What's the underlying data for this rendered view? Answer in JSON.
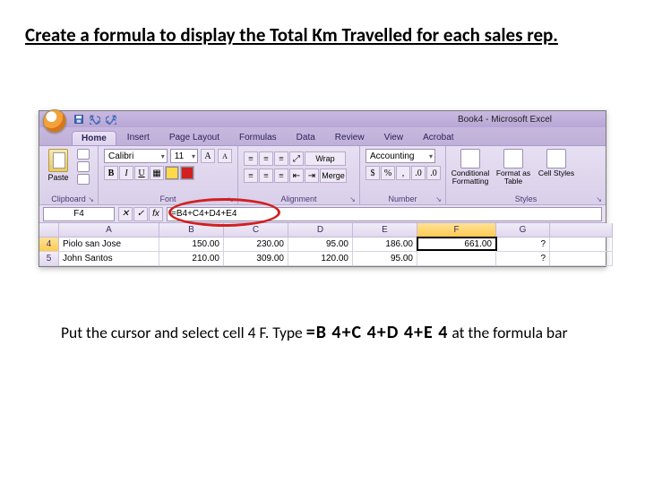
{
  "heading": "Create a formula to display the Total Km Travelled for each sales rep.",
  "window_title": "Book4 - Microsoft Excel",
  "tabs": [
    "Home",
    "Insert",
    "Page Layout",
    "Formulas",
    "Data",
    "Review",
    "View",
    "Acrobat"
  ],
  "ribbon": {
    "clipboard": {
      "paste": "Paste",
      "label": "Clipboard"
    },
    "font": {
      "face": "Calibri",
      "size": "11",
      "label": "Font",
      "buttons": {
        "bold": "B",
        "italic": "I",
        "underline": "U"
      }
    },
    "alignment": {
      "label": "Alignment"
    },
    "number": {
      "format": "Accounting",
      "label": "Number"
    },
    "styles": {
      "cond": "Conditional Formatting",
      "table": "Format as Table",
      "cell": "Cell Styles",
      "label": "Styles"
    }
  },
  "namebox": "F4",
  "formula": "=B4+C4+D4+E4",
  "grid": {
    "cols": [
      "",
      "A",
      "B",
      "C",
      "D",
      "E",
      "F",
      "G",
      ""
    ],
    "sel_col_index": 6,
    "rows": [
      {
        "num": "4",
        "selected": true,
        "cells": [
          "Piolo san Jose",
          "150.00",
          "230.00",
          "95.00",
          "186.00",
          "661.00",
          "?",
          ""
        ],
        "sel_cell_index": 5
      },
      {
        "num": "5",
        "selected": false,
        "cells": [
          "John Santos",
          "210.00",
          "309.00",
          "120.00",
          "95.00",
          "",
          "?",
          ""
        ],
        "sel_cell_index": -1
      }
    ]
  },
  "instruction": {
    "pre": "Put the cursor and select cell 4 F. Type ",
    "formula": "=B 4+C 4+D 4+E 4",
    "post": " at the formula bar"
  }
}
